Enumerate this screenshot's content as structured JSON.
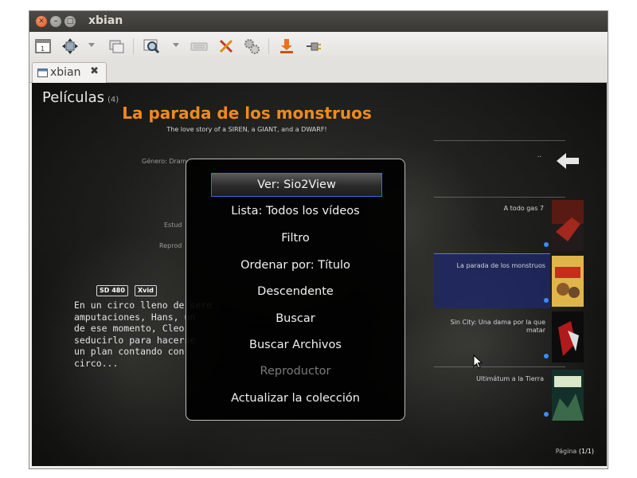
{
  "window": {
    "title": "xbian"
  },
  "toolbar": {
    "icons": [
      "screenshot-icon",
      "move-icon",
      "window-icon",
      "zoom-icon",
      "keyboard-icon",
      "tools-icon",
      "gears-icon",
      "download-icon",
      "plug-icon"
    ]
  },
  "tab": {
    "label": "xbian"
  },
  "library": {
    "section_title": "Películas",
    "count": "(4)",
    "movie_title": "La parada de los monstruos",
    "tagline": "The love story of a SIREN, a GIANT, and a DWARF!",
    "genre_label": "Género: Dram",
    "studio_label": "Estud",
    "player_label": "Reprod",
    "flags": [
      "SD 480",
      "Xvid"
    ],
    "plot": [
      "En un circo lleno de sere",
      "amputaciones, Hans, un",
      "de ese momento, Cleo",
      "seducirlo para hacerse",
      "un plan contando con",
      "circo..."
    ],
    "list_top_dots": "..",
    "list_items": [
      {
        "label": "A todo gas 7",
        "selected": false
      },
      {
        "label": "La parada de los monstruos",
        "selected": true
      },
      {
        "label": "Sin City: Una dama por la que matar",
        "selected": false
      },
      {
        "label": "Ultimátum a la Tierra",
        "selected": false
      }
    ],
    "page_label": "Página",
    "page_value": "(1/1)"
  },
  "context_menu": {
    "items": [
      {
        "label": "Ver: Sio2View",
        "focused": true,
        "disabled": false
      },
      {
        "label": "Lista: Todos los vídeos",
        "focused": false,
        "disabled": false
      },
      {
        "label": "Filtro",
        "focused": false,
        "disabled": false
      },
      {
        "label": "Ordenar por: Título",
        "focused": false,
        "disabled": false
      },
      {
        "label": "Descendente",
        "focused": false,
        "disabled": false
      },
      {
        "label": "Buscar",
        "focused": false,
        "disabled": false
      },
      {
        "label": "Buscar Archivos",
        "focused": false,
        "disabled": false
      },
      {
        "label": "Reproductor",
        "focused": false,
        "disabled": true
      },
      {
        "label": "Actualizar la colección",
        "focused": false,
        "disabled": false
      }
    ]
  },
  "colors": {
    "accent": "#f08a1c",
    "focus": "#3070e0",
    "selection": "#1e286e"
  }
}
